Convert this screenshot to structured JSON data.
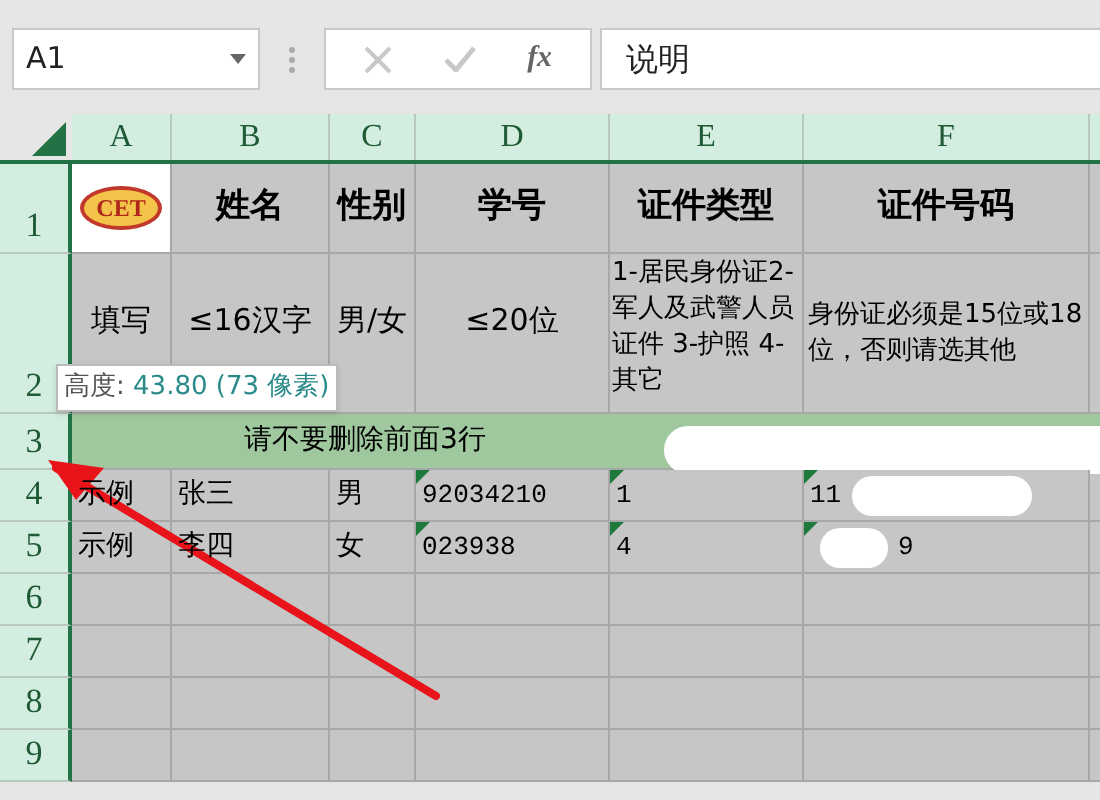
{
  "name_box": {
    "value": "A1"
  },
  "formula_bar": {
    "fx": "fx",
    "value": "说明"
  },
  "columns": [
    "A",
    "B",
    "C",
    "D",
    "E",
    "F"
  ],
  "rows": [
    {
      "header": "1",
      "kind": "title",
      "cells": [
        {
          "kind": "logo",
          "text": "CET"
        },
        {
          "text": "姓名"
        },
        {
          "text": "性别"
        },
        {
          "text": "学号"
        },
        {
          "text": "证件类型"
        },
        {
          "text": "证件号码"
        }
      ]
    },
    {
      "header": "2",
      "kind": "note",
      "cells": [
        {
          "text": "填写"
        },
        {
          "text": "≤16汉字"
        },
        {
          "text": "男/女"
        },
        {
          "text": "≤20位"
        },
        {
          "text": "1-居民身份证2-军人及武警人员证件 3-护照 4-其它"
        },
        {
          "text": "身份证必须是15位或18位，否则请选其他"
        }
      ]
    },
    {
      "header": "3",
      "kind": "banner",
      "text": "请不要删除前面3行"
    },
    {
      "header": "4",
      "kind": "data",
      "cells": [
        {
          "text": "示例"
        },
        {
          "text": "张三"
        },
        {
          "text": "男"
        },
        {
          "text": "92034210",
          "flag": true
        },
        {
          "text": "1",
          "flag": true
        },
        {
          "text": "11",
          "flag": true
        }
      ]
    },
    {
      "header": "5",
      "kind": "data",
      "cells": [
        {
          "text": "示例"
        },
        {
          "text": "李四"
        },
        {
          "text": "女"
        },
        {
          "text": "023938",
          "flag": true
        },
        {
          "text": "4",
          "flag": true
        },
        {
          "text": "9",
          "flag": true
        }
      ]
    },
    {
      "header": "6",
      "kind": "data"
    },
    {
      "header": "7",
      "kind": "data"
    },
    {
      "header": "8",
      "kind": "data"
    },
    {
      "header": "9",
      "kind": "data"
    }
  ],
  "tooltip": {
    "label": "高度:",
    "value": "43.80 (73 像素)"
  }
}
